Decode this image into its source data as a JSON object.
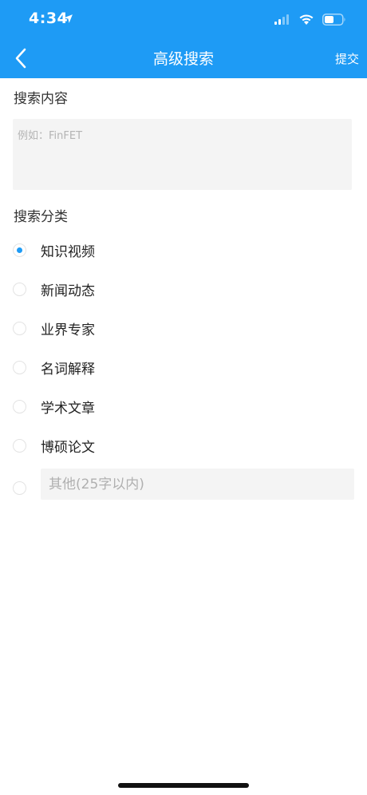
{
  "status_bar": {
    "time": "4:34"
  },
  "nav": {
    "title": "高级搜索",
    "submit_label": "提交"
  },
  "search": {
    "section_label": "搜索内容",
    "placeholder": "例如：FinFET",
    "value": ""
  },
  "category": {
    "section_label": "搜索分类",
    "options": [
      {
        "label": "知识视频",
        "checked": true
      },
      {
        "label": "新闻动态",
        "checked": false
      },
      {
        "label": "业界专家",
        "checked": false
      },
      {
        "label": "名词解释",
        "checked": false
      },
      {
        "label": "学术文章",
        "checked": false
      },
      {
        "label": "博硕论文",
        "checked": false
      }
    ],
    "other_placeholder": "其他(25字以内)",
    "other_value": ""
  },
  "colors": {
    "accent": "#1E9BF5",
    "input_bg": "#F4F4F4"
  }
}
